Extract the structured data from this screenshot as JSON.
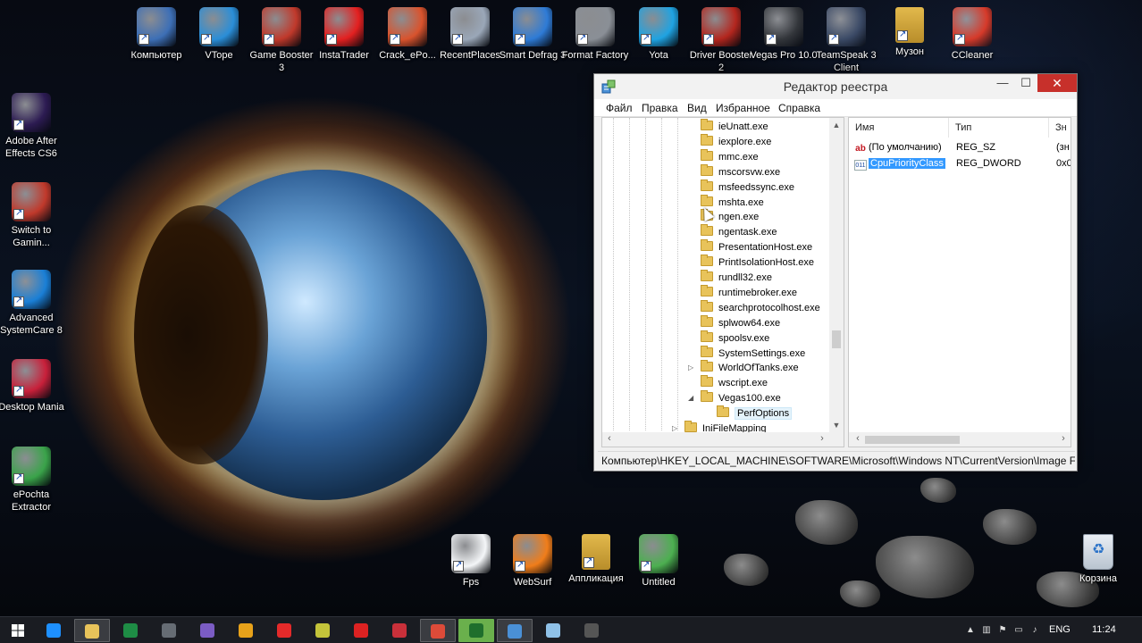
{
  "desktop": {
    "top_icons": [
      {
        "label": "Компьютер",
        "icon": "computer-icon",
        "color": "#3d6fb6"
      },
      {
        "label": "VTope",
        "icon": "vtope-icon",
        "color": "#2a8ed8"
      },
      {
        "label": "Game Booster 3",
        "icon": "game-booster-icon",
        "color": "#c0392b"
      },
      {
        "label": "InstaTrader",
        "icon": "instatrader-icon",
        "color": "#e32020"
      },
      {
        "label": "Crack_ePo...",
        "icon": "crack-epochta-icon",
        "color": "#d9532d"
      },
      {
        "label": "RecentPlaces",
        "icon": "recent-places-icon",
        "color": "#9aa7b8"
      },
      {
        "label": "Smart Defrag 3",
        "icon": "smart-defrag-icon",
        "color": "#2e7bd6"
      },
      {
        "label": "Format Factory",
        "icon": "format-factory-icon",
        "color": "#8a8f96"
      },
      {
        "label": "Yota",
        "icon": "yota-icon",
        "color": "#1fa3e2"
      },
      {
        "label": "Driver Booster 2",
        "icon": "driver-booster-icon",
        "color": "#b3261e"
      },
      {
        "label": "Vegas Pro 10.0",
        "icon": "vegas-pro-icon",
        "color": "#33363b"
      },
      {
        "label": "TeamSpeak 3 Client",
        "icon": "teamspeak-icon",
        "color": "#3b4a66"
      },
      {
        "label": "Музон",
        "icon": "folder-icon",
        "color": "#e2b94c"
      },
      {
        "label": "CCleaner",
        "icon": "ccleaner-icon",
        "color": "#d63a2a"
      }
    ],
    "left_icons": [
      {
        "label": "Adobe After Effects CS6",
        "icon": "after-effects-icon",
        "color": "#2c1b52"
      },
      {
        "label": "Switch to Gamin...",
        "icon": "switch-gaming-icon",
        "color": "#c0392b"
      },
      {
        "label": "Advanced SystemCare 8",
        "icon": "advanced-systemcare-icon",
        "color": "#1a7fd6"
      },
      {
        "label": "Desktop Mania",
        "icon": "desktop-mania-icon",
        "color": "#c8203a"
      },
      {
        "label": "ePochta Extractor",
        "icon": "epochta-extractor-icon",
        "color": "#3aa34a"
      }
    ],
    "bottom_icons": [
      {
        "label": "Fps",
        "icon": "text-file-icon",
        "color": "#f4f6f8"
      },
      {
        "label": "WebSurf",
        "icon": "websurf-icon",
        "color": "#f07d1a"
      },
      {
        "label": "Аппликация",
        "icon": "folder-icon",
        "color": "#e2b94c"
      },
      {
        "label": "Untitled",
        "icon": "project-file-icon",
        "color": "#4caf50"
      }
    ],
    "recycle_bin": {
      "label": "Корзина",
      "icon": "recycle-bin-icon"
    }
  },
  "regedit": {
    "title": "Редактор реестра",
    "controls": {
      "minimize": "—",
      "maximize": "☐",
      "close": "✕"
    },
    "menu": [
      "Файл",
      "Правка",
      "Вид",
      "Избранное",
      "Справка"
    ],
    "tree": [
      {
        "label": "ieUnatt.exe",
        "expander": ""
      },
      {
        "label": "iexplore.exe",
        "expander": ""
      },
      {
        "label": "mmc.exe",
        "expander": ""
      },
      {
        "label": "mscorsvw.exe",
        "expander": ""
      },
      {
        "label": "msfeedssync.exe",
        "expander": ""
      },
      {
        "label": "mshta.exe",
        "expander": ""
      },
      {
        "label": "ngen.exe",
        "expander": ""
      },
      {
        "label": "ngentask.exe",
        "expander": ""
      },
      {
        "label": "PresentationHost.exe",
        "expander": ""
      },
      {
        "label": "PrintIsolationHost.exe",
        "expander": ""
      },
      {
        "label": "rundll32.exe",
        "expander": ""
      },
      {
        "label": "runtimebroker.exe",
        "expander": ""
      },
      {
        "label": "searchprotocolhost.exe",
        "expander": ""
      },
      {
        "label": "splwow64.exe",
        "expander": ""
      },
      {
        "label": "spoolsv.exe",
        "expander": ""
      },
      {
        "label": "SystemSettings.exe",
        "expander": ""
      },
      {
        "label": "WorldOfTanks.exe",
        "expander": "▷"
      },
      {
        "label": "wscript.exe",
        "expander": ""
      },
      {
        "label": "Vegas100.exe",
        "expander": "◢"
      },
      {
        "label": "PerfOptions",
        "expander": "",
        "child": true,
        "selected": true
      },
      {
        "label": "IniFileMapping",
        "expander": "▷",
        "parent": true
      }
    ],
    "columns": [
      "Имя",
      "Тип",
      "Зн"
    ],
    "values": [
      {
        "name": "(По умолчанию)",
        "type": "REG_SZ",
        "data": "(зн",
        "icon": "ab"
      },
      {
        "name": "CpuPriorityClass",
        "type": "REG_DWORD",
        "data": "0x0",
        "icon": "011",
        "selected": true
      }
    ],
    "status_path": "Компьютер\\HKEY_LOCAL_MACHINE\\SOFTWARE\\Microsoft\\Windows NT\\CurrentVersion\\Image File E"
  },
  "taskbar": {
    "apps": [
      {
        "icon": "start-icon",
        "color": "#ffffff"
      },
      {
        "icon": "internet-explorer-icon",
        "color": "#1e90ff"
      },
      {
        "icon": "file-explorer-icon",
        "color": "#e8c35a",
        "active": true
      },
      {
        "icon": "excel-icon",
        "color": "#1e8c45"
      },
      {
        "icon": "calculator-icon",
        "color": "#666c74"
      },
      {
        "icon": "viber-icon",
        "color": "#7b5cc4"
      },
      {
        "icon": "chrome-icon",
        "color": "#e8a21a"
      },
      {
        "icon": "yandex-browser-icon",
        "color": "#e52a2a"
      },
      {
        "icon": "instatrader-icon",
        "color": "#c4c43a"
      },
      {
        "icon": "red-app-icon",
        "color": "#d22"
      },
      {
        "icon": "settings-gear-icon",
        "color": "#c9303a"
      },
      {
        "icon": "chrome-icon",
        "color": "#dd4b39",
        "active": true
      },
      {
        "icon": "instatrader-icon",
        "color": "#1f6f2c",
        "highlight": true
      },
      {
        "icon": "regedit-icon",
        "color": "#4a90d6",
        "active": true
      },
      {
        "icon": "notepad-icon",
        "color": "#8fc1e8"
      },
      {
        "icon": "monitor-icon",
        "color": "#555"
      }
    ],
    "language": "ENG",
    "clock": "11:24"
  }
}
